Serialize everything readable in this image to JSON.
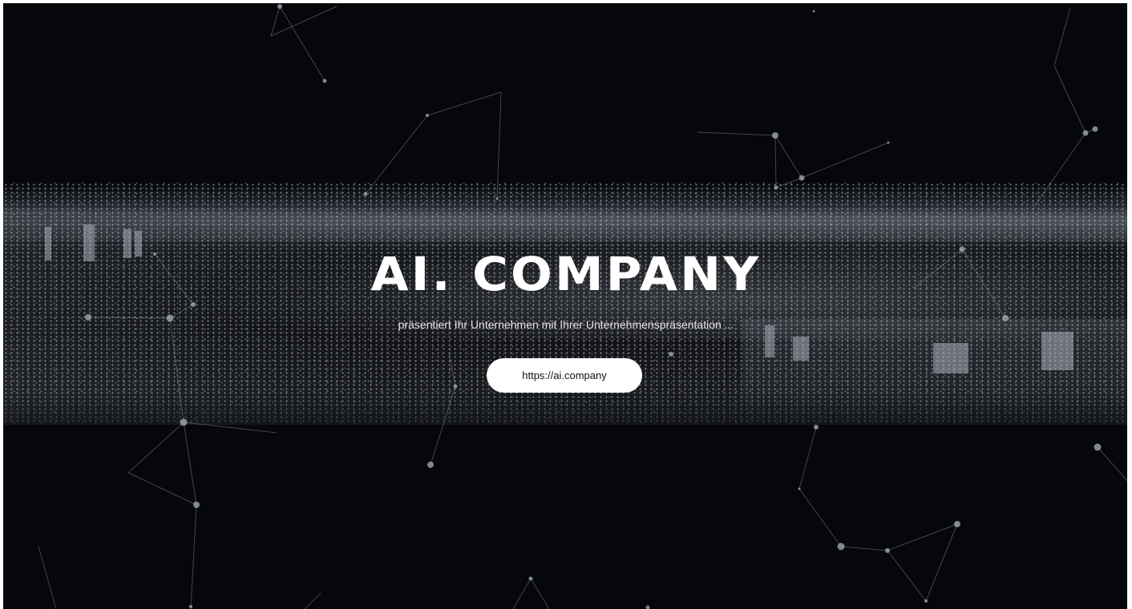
{
  "hero": {
    "title": "AI. COMPANY",
    "subtitle": "präsentiert Ihr Unternehmen mit Ihrer Unternehmenspräsentation ...",
    "cta_label": "https://ai.company"
  },
  "colors": {
    "background": "#05070b",
    "text": "#ffffff",
    "button_bg": "#ffffff",
    "button_text": "#111111"
  }
}
